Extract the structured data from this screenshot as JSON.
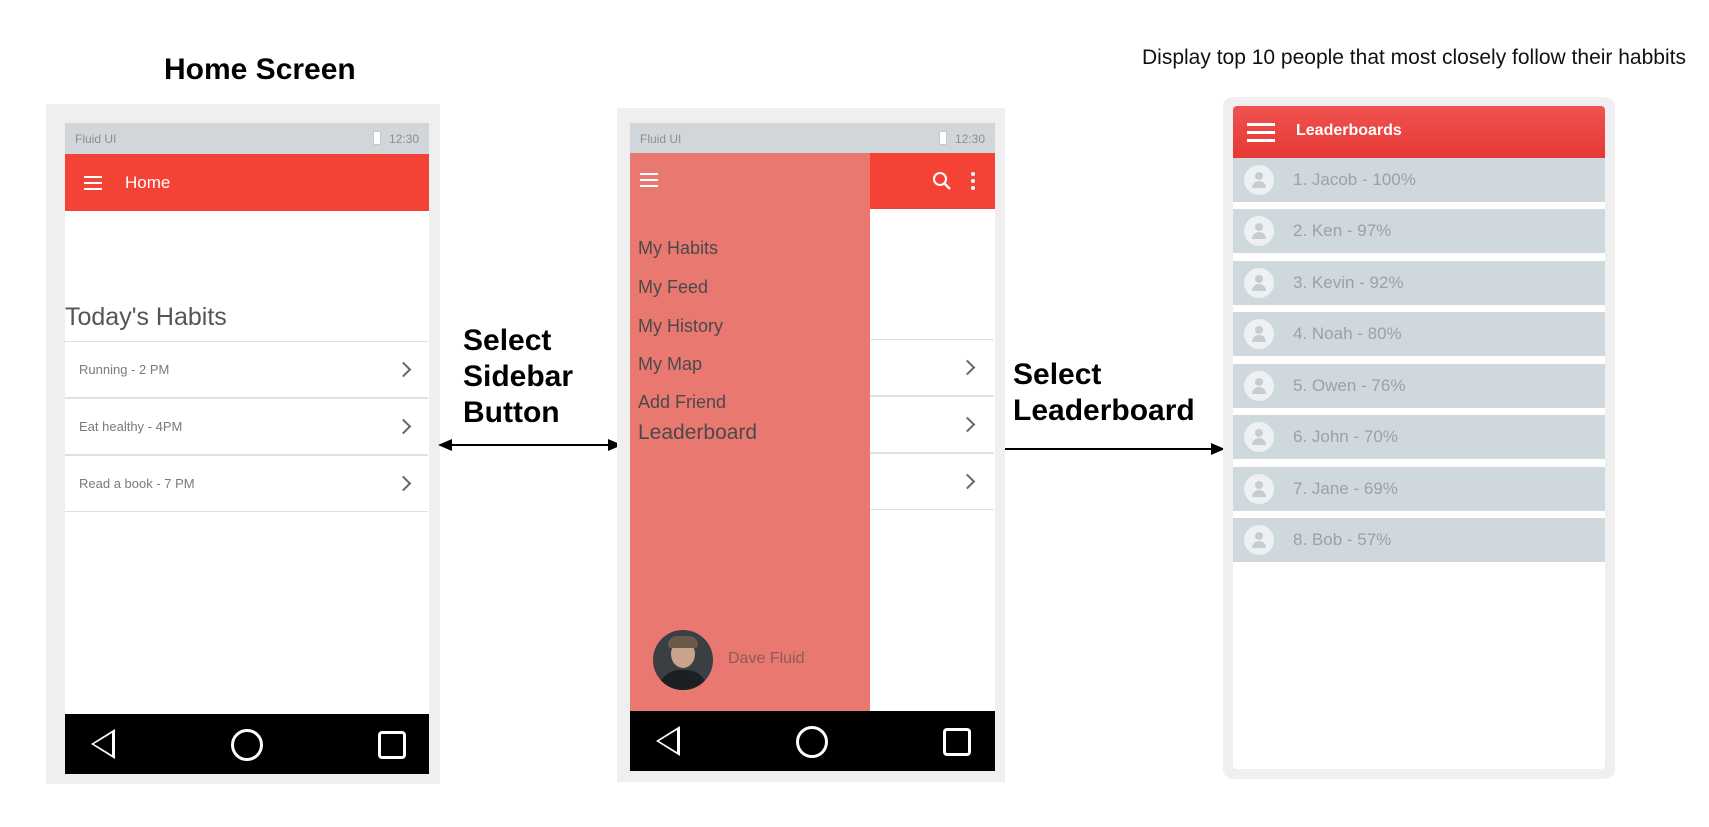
{
  "captions": {
    "home_screen": "Home Screen",
    "leaderboard_note": "Display top 10 people that most closely follow their habbits"
  },
  "arrows": {
    "sidebar": [
      "Select",
      "Sidebar",
      "Button"
    ],
    "leaderboard": [
      "Select",
      "Leaderboard"
    ]
  },
  "home": {
    "status": {
      "app": "Fluid UI",
      "time": "12:30"
    },
    "appbar_title": "Home",
    "section_title": "Today's Habits",
    "habits": [
      "Running - 2 PM",
      "Eat healthy - 4PM",
      "Read a book - 7 PM"
    ]
  },
  "sidebar_screen": {
    "status": {
      "app": "Fluid UI",
      "time": "12:30"
    },
    "menu_items": [
      "My Habits",
      "My Feed",
      "My History",
      "My Map",
      "Add Friend"
    ],
    "leaderboard_item": "Leaderboard",
    "user_name": "Dave Fluid"
  },
  "leaderboards": {
    "title": "Leaderboards",
    "entries": [
      "1. Jacob - 100%",
      "2. Ken - 97%",
      "3. Kevin - 92%",
      "4. Noah - 80%",
      "5. Owen - 76%",
      "6. John - 70%",
      "7. Jane - 69%",
      "8. Bob - 57%"
    ]
  },
  "colors": {
    "accent": "#f44336",
    "drawer": "#e87870",
    "status_bar": "#d0d6da",
    "leaderboard_row": "#cfd8dc"
  },
  "icons": [
    "menu-icon",
    "search-icon",
    "more-vert-icon",
    "chevron-right-icon",
    "back-icon",
    "home-icon",
    "recents-icon",
    "person-icon",
    "battery-icon"
  ]
}
